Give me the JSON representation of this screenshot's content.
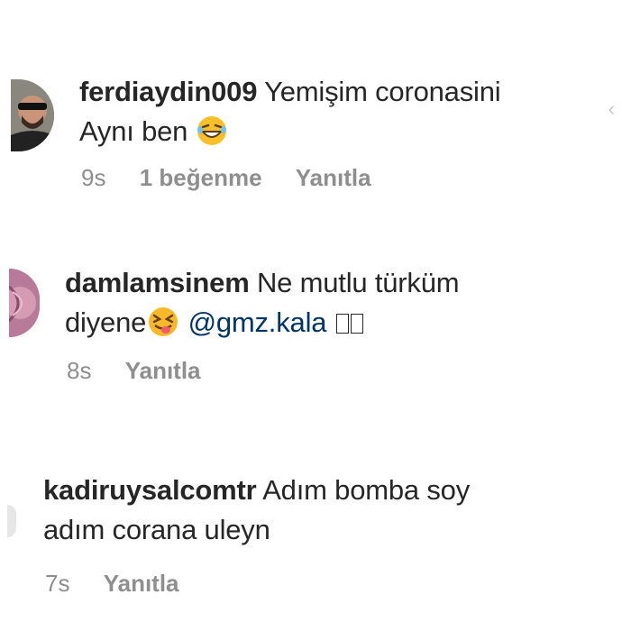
{
  "comments": [
    {
      "username": "ferdiaydin009",
      "text_line1": "Yemişim coronasini",
      "text_line2": "Aynı  ben",
      "time": "9s",
      "likes": "1 beğenme",
      "reply": "Yanıtla",
      "emoji": "grinning-squinting-face"
    },
    {
      "username": "damlamsinem",
      "text_line1": "Ne mutlu türküm",
      "text_line2": "diyene",
      "mention": "@gmz.kala",
      "time": "8s",
      "reply": "Yanıtla",
      "emoji": "squinting-tongue-face"
    },
    {
      "username": "kadiruysalcomtr",
      "text_line1": "Adım bomba soy",
      "text_line2": "adım corana uleyn",
      "time": "7s",
      "reply": "Yanıtla"
    }
  ],
  "colors": {
    "text": "#262626",
    "meta": "#8e8e8e",
    "mention": "#003569"
  }
}
